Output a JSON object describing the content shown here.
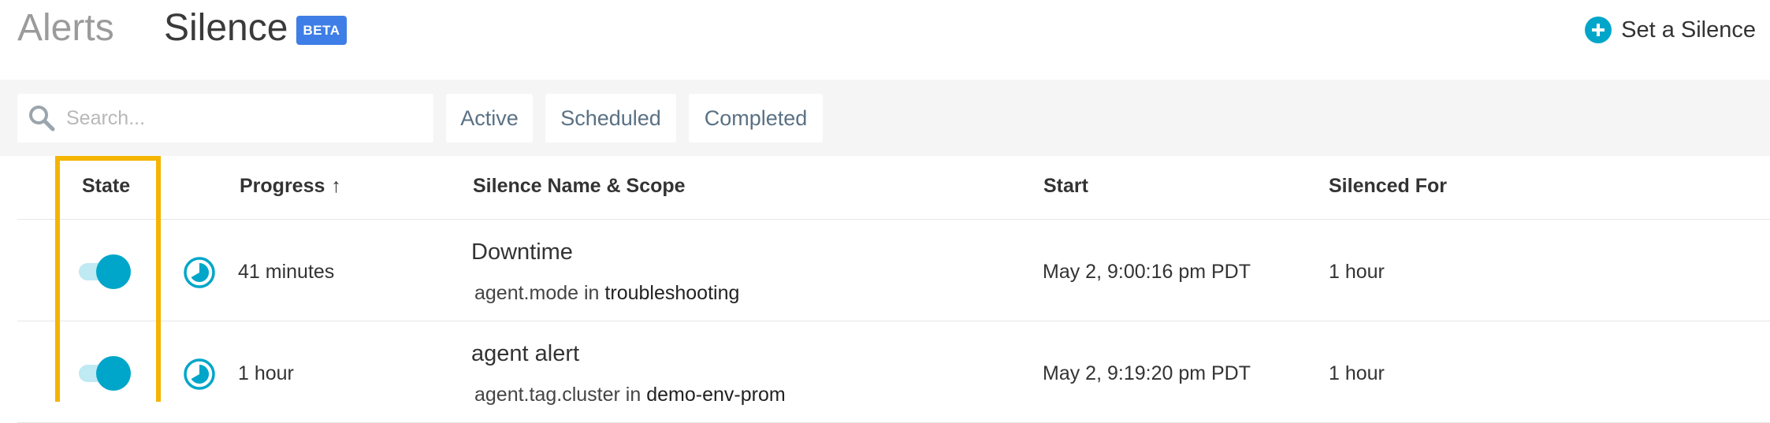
{
  "header": {
    "nav_alerts": "Alerts",
    "nav_silence": "Silence",
    "beta_badge": "BETA",
    "set_silence_label": "Set a Silence"
  },
  "toolbar": {
    "search_placeholder": "Search...",
    "filters": [
      "Active",
      "Scheduled",
      "Completed"
    ]
  },
  "table": {
    "columns": {
      "state": "State",
      "progress": "Progress",
      "progress_sort": "↑",
      "name": "Silence Name & Scope",
      "start": "Start",
      "silenced_for": "Silenced For"
    },
    "rows": [
      {
        "state_on": true,
        "progress": "41 minutes",
        "name": "Downtime",
        "scope_label": "agent.mode",
        "scope_op": "in",
        "scope_value": "troubleshooting",
        "start": "May 2, 9:00:16 pm PDT",
        "silenced_for": "1 hour"
      },
      {
        "state_on": true,
        "progress": "1 hour",
        "name": "agent alert",
        "scope_label": "agent.tag.cluster",
        "scope_op": "in",
        "scope_value": "demo-env-prom",
        "start": "May 2, 9:19:20 pm PDT",
        "silenced_for": "1 hour"
      }
    ]
  },
  "colors": {
    "accent": "#00a6c9",
    "beta_badge": "#3e7ee6",
    "highlight": "#f4b400",
    "toolbar_bg": "#f5f5f5"
  },
  "icons": {
    "add": "plus-circle-icon",
    "search": "search-icon",
    "progress": "clock-progress-icon"
  }
}
